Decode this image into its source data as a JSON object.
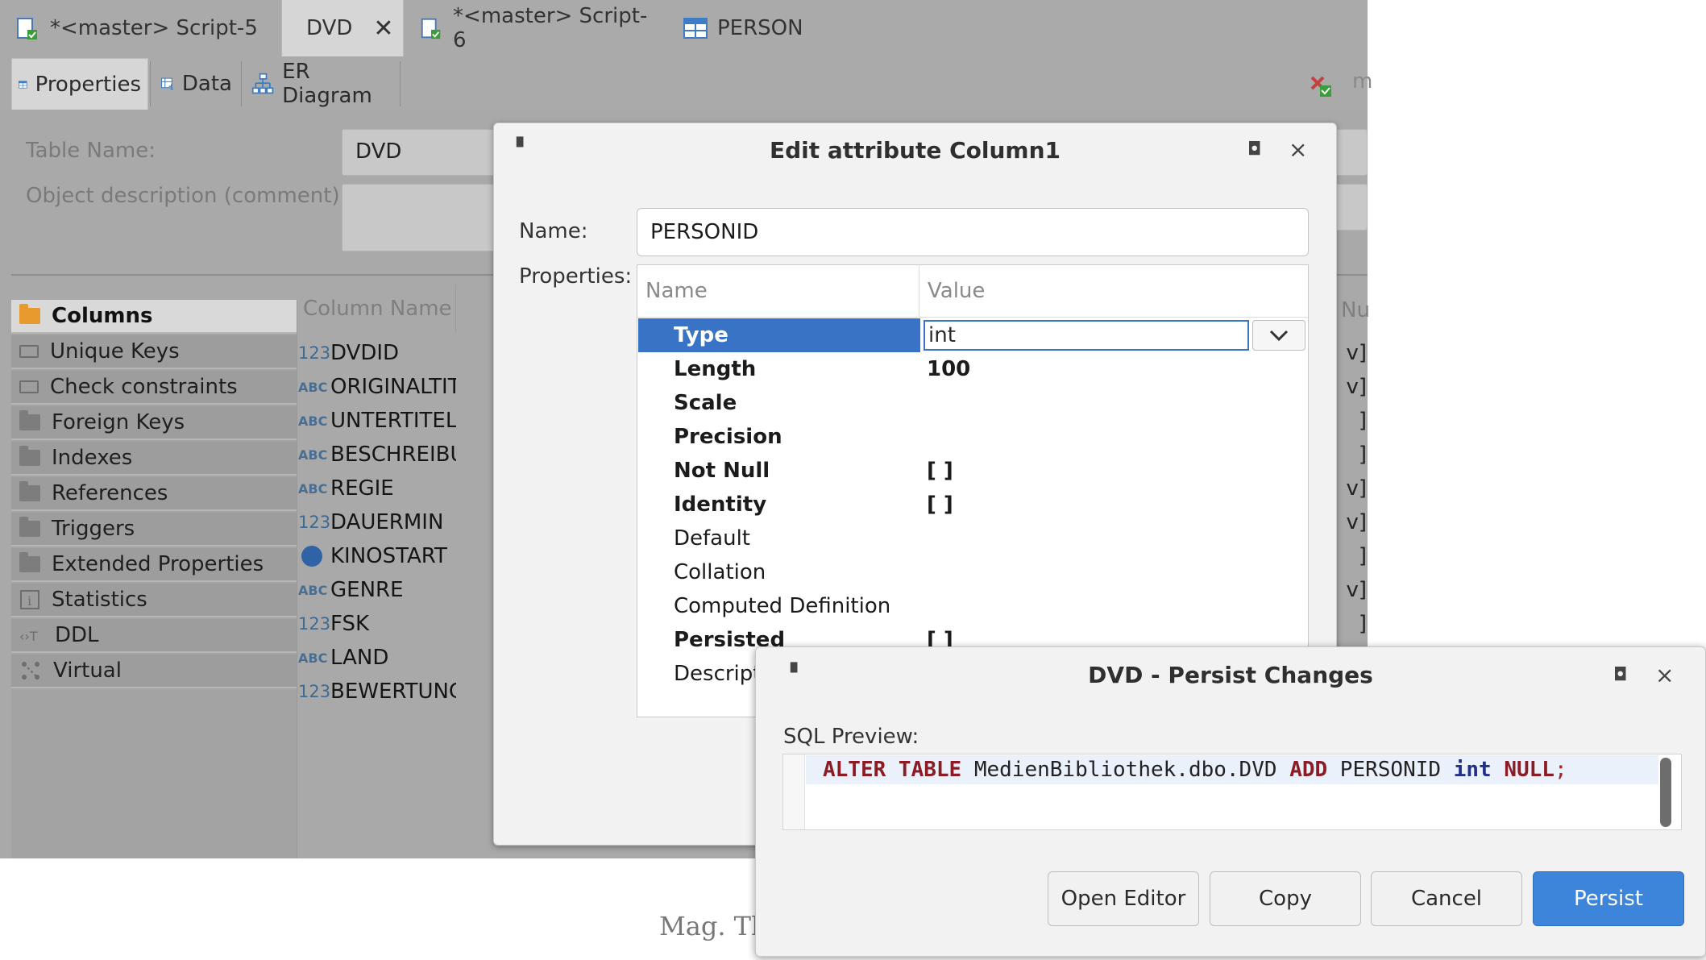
{
  "tabs": [
    {
      "label": "*<master> Script-5",
      "icon": "sql-script-icon"
    },
    {
      "label": "DVD",
      "icon": "table-icon",
      "close": "✕"
    },
    {
      "label": "*<master> Script-6",
      "icon": "sql-script-icon"
    },
    {
      "label": "PERSON",
      "icon": "table-icon"
    }
  ],
  "subtabs": [
    {
      "label": "Properties",
      "icon": "table-icon"
    },
    {
      "label": "Data",
      "icon": "data-grid-icon"
    },
    {
      "label": "ER Diagram",
      "icon": "er-diagram-icon"
    }
  ],
  "toolbar_overflow": "m",
  "table_form": {
    "table_name_label": "Table Name:",
    "table_name_value": "DVD",
    "description_label": "Object description (comment):"
  },
  "nav_items": [
    {
      "label": "Columns",
      "icon": "folder-icon",
      "active": true
    },
    {
      "label": "Unique Keys",
      "icon": "key-icon"
    },
    {
      "label": "Check constraints",
      "icon": "constraint-icon"
    },
    {
      "label": "Foreign Keys",
      "icon": "folder-icon"
    },
    {
      "label": "Indexes",
      "icon": "folder-icon"
    },
    {
      "label": "References",
      "icon": "folder-icon"
    },
    {
      "label": "Triggers",
      "icon": "folder-icon"
    },
    {
      "label": "Extended Properties",
      "icon": "folder-icon"
    },
    {
      "label": "Statistics",
      "icon": "info-icon"
    },
    {
      "label": "DDL",
      "icon": "ddl-icon"
    },
    {
      "label": "Virtual",
      "icon": "virtual-icon"
    }
  ],
  "columns_header": "Column Name",
  "columns_right_header": "Nu",
  "columns": [
    {
      "name": "DVDID",
      "type": "123",
      "right": "v]"
    },
    {
      "name": "ORIGINALTITE",
      "type": "ABC",
      "right": "v]"
    },
    {
      "name": "UNTERTITEL",
      "type": "ABC",
      "right": "]"
    },
    {
      "name": "BESCHREIBU",
      "type": "ABC",
      "right": "]"
    },
    {
      "name": "REGIE",
      "type": "ABC",
      "right": "v]"
    },
    {
      "name": "DAUERMIN",
      "type": "123",
      "right": "v]"
    },
    {
      "name": "KINOSTART",
      "type": "date",
      "right": "]"
    },
    {
      "name": "GENRE",
      "type": "ABC",
      "right": "v]"
    },
    {
      "name": "FSK",
      "type": "123",
      "right": "]"
    },
    {
      "name": "LAND",
      "type": "ABC",
      "right": ""
    },
    {
      "name": "BEWERTUNG",
      "type": "123",
      "right": ""
    }
  ],
  "caption": "Mag. Th",
  "edit_dialog": {
    "title": "Edit attribute Column1",
    "name_label": "Name:",
    "name_value": "PERSONID",
    "properties_label": "Properties:",
    "col_name": "Name",
    "col_value": "Value",
    "type_value": "int",
    "rows": [
      {
        "name": "Type",
        "value": "",
        "bold": true
      },
      {
        "name": "Length",
        "value": "100",
        "bold": true
      },
      {
        "name": "Scale",
        "value": "",
        "bold": true
      },
      {
        "name": "Precision",
        "value": "",
        "bold": true
      },
      {
        "name": "Not Null",
        "value": "[ ]",
        "bold": true
      },
      {
        "name": "Identity",
        "value": "[ ]",
        "bold": true
      },
      {
        "name": "Default",
        "value": "",
        "bold": false
      },
      {
        "name": "Collation",
        "value": "",
        "bold": false
      },
      {
        "name": "Computed Definition",
        "value": "",
        "bold": false
      },
      {
        "name": "Persisted",
        "value": "[ ]",
        "bold": true
      },
      {
        "name": "Descripti",
        "value": "",
        "bold": false
      }
    ]
  },
  "persist_dialog": {
    "title": "DVD - Persist Changes",
    "sql_label": "SQL Preview:",
    "sql": {
      "kw1": "ALTER TABLE",
      "obj": " MedienBibliothek.dbo.DVD ",
      "kw2": "ADD",
      "col": " PERSONID ",
      "type": "int",
      "kw3": " NULL",
      "end": ";"
    },
    "buttons": [
      "Open Editor",
      "Copy",
      "Cancel",
      "Persist"
    ]
  },
  "window_controls": {
    "pin": "▘",
    "maximize": "◘",
    "close": "×"
  },
  "colors": {
    "accent": "#3d84db",
    "selection": "#3873c6",
    "sql_keyword": "#8b1c23"
  }
}
